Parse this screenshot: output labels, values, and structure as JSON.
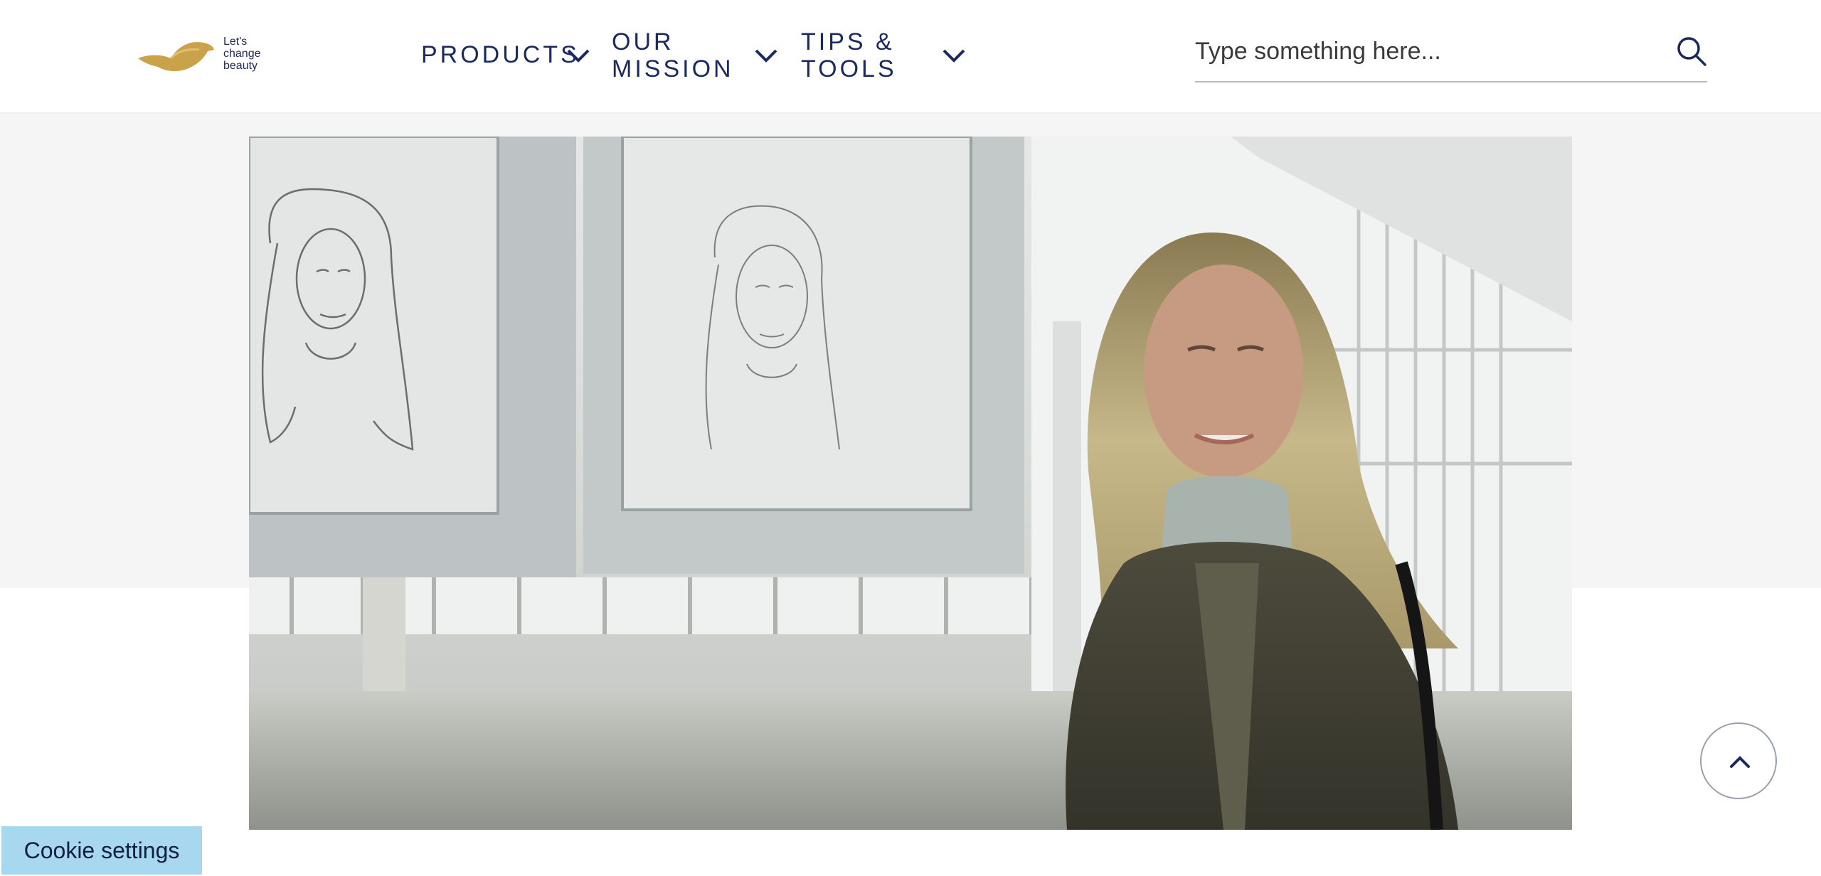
{
  "logo": {
    "line1": "Let's",
    "line2": "change",
    "line3": "beauty",
    "icon": "dove-icon",
    "color": "#c9a24a"
  },
  "nav": {
    "items": [
      {
        "label_lines": [
          "PRODUCTS"
        ],
        "icon": "chevron-down-icon"
      },
      {
        "label_lines": [
          "OUR",
          "MISSION"
        ],
        "icon": "chevron-down-icon"
      },
      {
        "label_lines": [
          "TIPS &",
          "TOOLS"
        ],
        "icon": "chevron-down-icon"
      }
    ],
    "color": "#1b2a5e"
  },
  "search": {
    "placeholder": "Type something here...",
    "value": "",
    "icon": "search-icon"
  },
  "hero": {
    "image_alt": "Woman smiling in front of two framed pencil sketch portraits",
    "interactive": "video"
  },
  "back_to_top": {
    "icon": "chevron-up-icon"
  },
  "cookie": {
    "label": "Cookie settings",
    "color": "#a8d8f0"
  }
}
